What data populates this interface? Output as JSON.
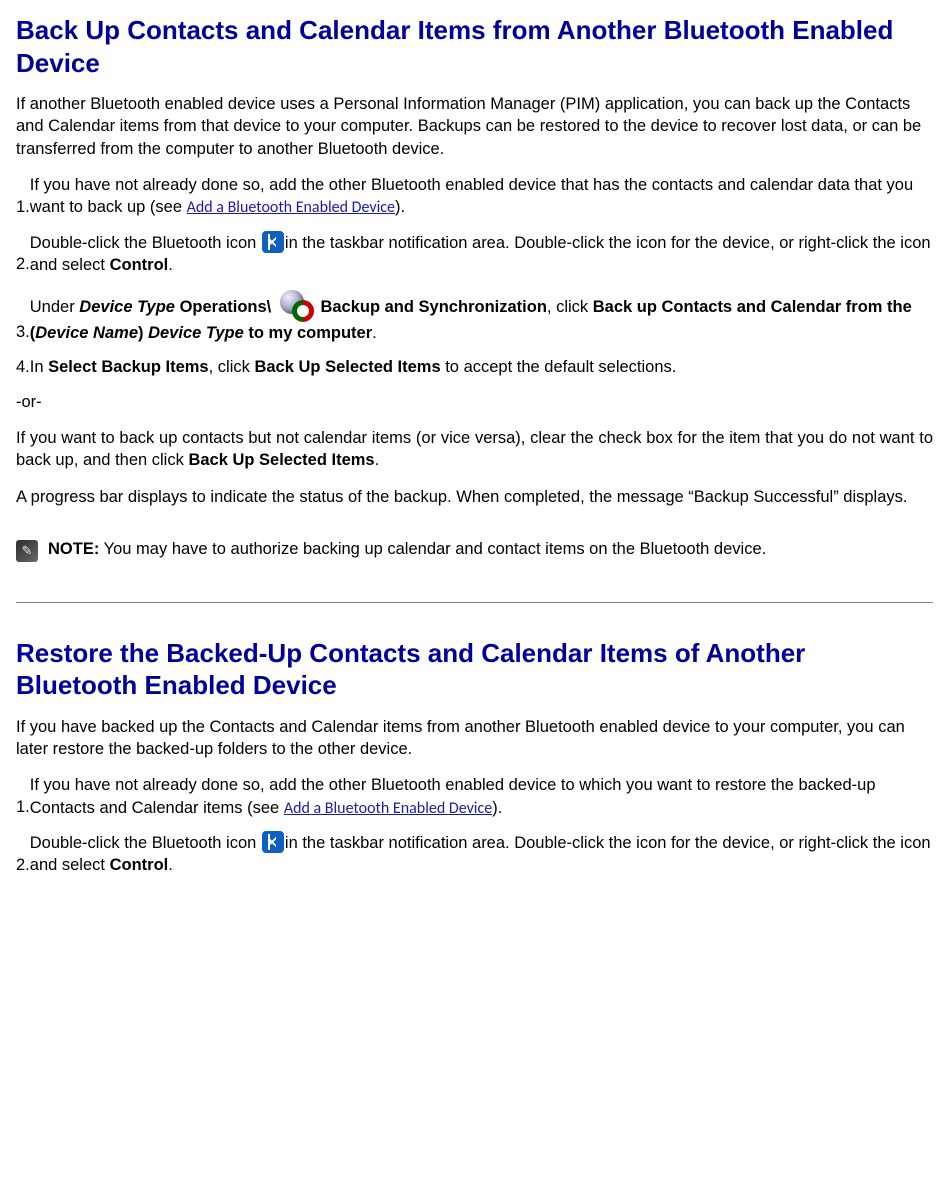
{
  "section1": {
    "title": "Back Up Contacts and Calendar Items from Another Bluetooth Enabled Device",
    "intro": "If another Bluetooth enabled device uses a Personal Information Manager (PIM) application, you can back up the Contacts and Calendar items from that device to your computer. Backups can be restored to the device to recover lost data, or can be transferred from the computer to another Bluetooth device.",
    "step1_a": "If you have not already done so, add the other Bluetooth enabled device that has the contacts and calendar data that you want to back up (see ",
    "step1_link": "Add a Bluetooth Enabled Device",
    "step1_b": ").",
    "step2_a": "Double-click the Bluetooth icon ",
    "step2_b": "in the taskbar notification area. Double-click the icon for the device, or right-click the icon and select ",
    "step2_bold": "Control",
    "step2_c": ".",
    "step3_a": "Under ",
    "step3_b": "Device Type",
    "step3_c": " Operations\\ ",
    "step3_d": " Backup and Synchronization",
    "step3_e": ", click ",
    "step3_f": "Back up Contacts and Calendar from the (",
    "step3_g": "Device Name",
    "step3_h": ") ",
    "step3_i": "Device Type",
    "step3_j": " to my computer",
    "step3_k": ".",
    "step4_a": "In ",
    "step4_b": "Select Backup Items",
    "step4_c": ", click ",
    "step4_d": "Back Up Selected Items",
    "step4_e": " to accept the default selections.",
    "or": "-or-",
    "alt_a": "If you want to back up contacts but not calendar items (or vice versa), clear the check box for the item that you do not want to back up, and then click ",
    "alt_b": "Back Up Selected Items",
    "alt_c": ".",
    "progress": "A progress bar displays to indicate the status of the backup. When completed, the message “Backup Successful” displays.",
    "note_label": "NOTE:",
    "note_text": " You may have to authorize backing up calendar and contact items on the Bluetooth device."
  },
  "section2": {
    "title": "Restore the Backed-Up Contacts and Calendar Items of Another Bluetooth Enabled Device",
    "intro": "If you have backed up the Contacts and Calendar items from another Bluetooth enabled device to your computer, you can later restore the backed-up folders to the other device.",
    "step1_a": "If you have not already done so, add the other Bluetooth enabled device to which you want to restore the backed-up Contacts and Calendar items (see ",
    "step1_link": "Add a Bluetooth Enabled Device",
    "step1_b": ").",
    "step2_a": "Double-click the Bluetooth icon ",
    "step2_b": "in the taskbar notification area. Double-click the icon for the device, or right-click the icon and select ",
    "step2_bold": "Control",
    "step2_c": "."
  },
  "nums": {
    "n1": "1.",
    "n2": "2.",
    "n3": "3.",
    "n4": "4."
  }
}
